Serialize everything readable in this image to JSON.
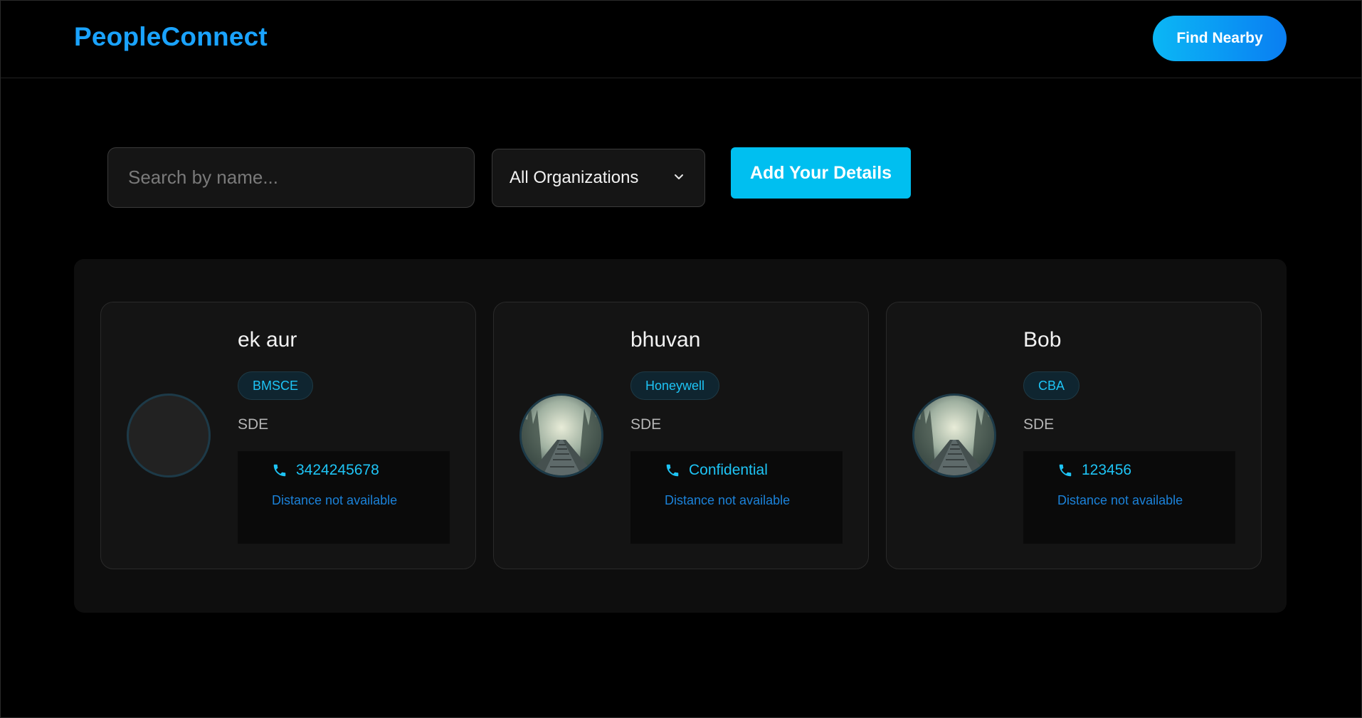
{
  "app": {
    "brand": "PeopleConnect",
    "find_nearby_label": "Find Nearby"
  },
  "controls": {
    "search_placeholder": "Search by name...",
    "search_value": "",
    "org_selected": "All Organizations",
    "add_details_label": "Add Your Details"
  },
  "colors": {
    "accent": "#1aa3ff",
    "button": "#00bff0",
    "badge_text": "#1ec4f5",
    "distance_text": "#1b82d9",
    "background": "#000000"
  },
  "people": [
    {
      "name": "ek aur",
      "organization": "BMSCE",
      "role": "SDE",
      "phone": "3424245678",
      "distance": "Distance not available",
      "avatar": "empty-avatar"
    },
    {
      "name": "bhuvan",
      "organization": "Honeywell",
      "role": "SDE",
      "phone": "Confidential",
      "distance": "Distance not available",
      "avatar": "misty-forest-railway-photo"
    },
    {
      "name": "Bob",
      "organization": "CBA",
      "role": "SDE",
      "phone": "123456",
      "distance": "Distance not available",
      "avatar": "misty-forest-railway-photo"
    }
  ],
  "icons": {
    "phone": "phone-icon",
    "dropdown": "chevron-down-icon"
  }
}
